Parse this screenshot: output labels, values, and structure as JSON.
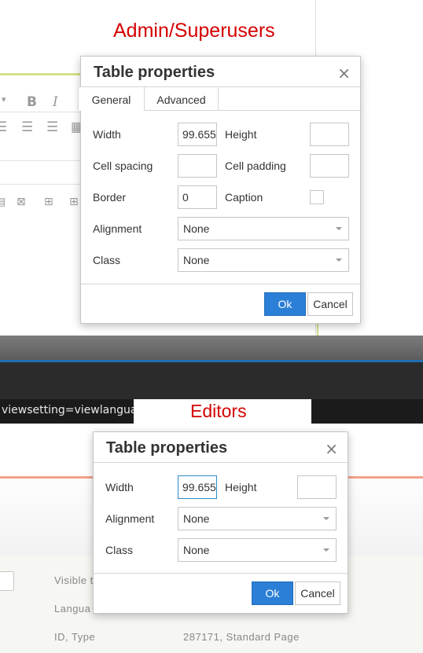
{
  "annotations": {
    "admin_caption": "Admin/Superusers",
    "editors_caption": "Editors"
  },
  "browser": {
    "url_fragment": "viewsetting=viewlanguage:"
  },
  "admin_dialog": {
    "title": "Table properties",
    "close_icon": "×",
    "tabs": [
      "General",
      "Advanced"
    ],
    "active_tab": "General",
    "fields": {
      "width_label": "Width",
      "width_value": "99.655",
      "height_label": "Height",
      "height_value": "",
      "cell_spacing_label": "Cell spacing",
      "cell_spacing_value": "",
      "cell_padding_label": "Cell padding",
      "cell_padding_value": "",
      "border_label": "Border",
      "border_value": "0",
      "caption_label": "Caption",
      "caption_checked": false,
      "alignment_label": "Alignment",
      "alignment_value": "None",
      "class_label": "Class",
      "class_value": "None"
    },
    "ok_label": "Ok",
    "cancel_label": "Cancel"
  },
  "editor_dialog": {
    "title": "Table properties",
    "close_icon": "×",
    "fields": {
      "width_label": "Width",
      "width_value": "99.655",
      "height_label": "Height",
      "height_value": "",
      "alignment_label": "Alignment",
      "alignment_value": "None",
      "class_label": "Class",
      "class_value": "None"
    },
    "ok_label": "Ok",
    "cancel_label": "Cancel"
  },
  "background_page": {
    "visible_label": "Visible t",
    "language_label": "Langua",
    "id_type_label": "ID, Type",
    "id_type_value": "287171, Standard Page"
  },
  "toolbar_icons": [
    "bold-icon",
    "italic-icon",
    "align-left-icon",
    "align-center-icon",
    "align-right-icon",
    "delete-table-icon",
    "insert-row-icon"
  ],
  "colors": {
    "annotation_red": "#d40000",
    "ok_blue": "#2b7fd6",
    "editor_accent_yellow": "#d6df86",
    "editor_accent_salmon": "#f5a08a"
  }
}
